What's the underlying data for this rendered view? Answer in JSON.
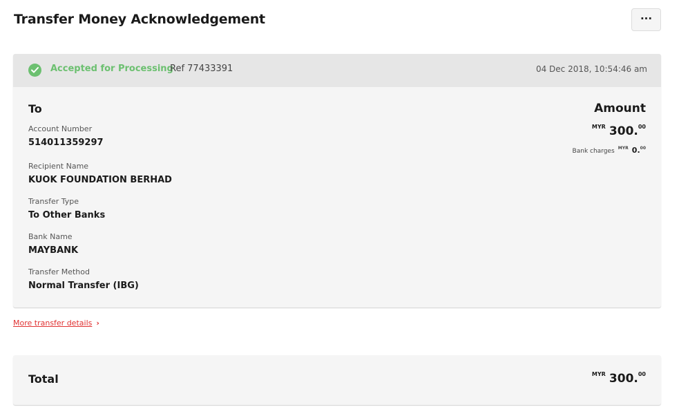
{
  "header": {
    "title": "Transfer Money Acknowledgement",
    "more_label": "···"
  },
  "status": {
    "icon": "check-circle-icon",
    "color": "#6cc070",
    "label": "Accepted for Processing",
    "ref": "Ref 77433391",
    "datetime": "04 Dec 2018, 10:54:46 am"
  },
  "details": {
    "to_heading": "To",
    "amount_heading": "Amount",
    "fields": [
      {
        "label": "Account Number",
        "value": "514011359297"
      },
      {
        "label": "Recipient Name",
        "value": "KUOK FOUNDATION BERHAD"
      },
      {
        "label": "Transfer Type",
        "value": "To Other Banks"
      },
      {
        "label": "Bank Name",
        "value": "MAYBANK"
      },
      {
        "label": "Transfer Method",
        "value": "Normal Transfer (IBG)"
      }
    ],
    "amount": {
      "currency": "MYR",
      "integer": "300.",
      "decimal": "00"
    },
    "charges": {
      "label": "Bank charges",
      "currency": "MYR",
      "integer": "0.",
      "decimal": "00"
    }
  },
  "more_details_link": {
    "label": "More transfer details",
    "chevron": "›",
    "color": "#e03131"
  },
  "total": {
    "label": "Total",
    "currency": "MYR",
    "integer": "300.",
    "decimal": "00"
  }
}
